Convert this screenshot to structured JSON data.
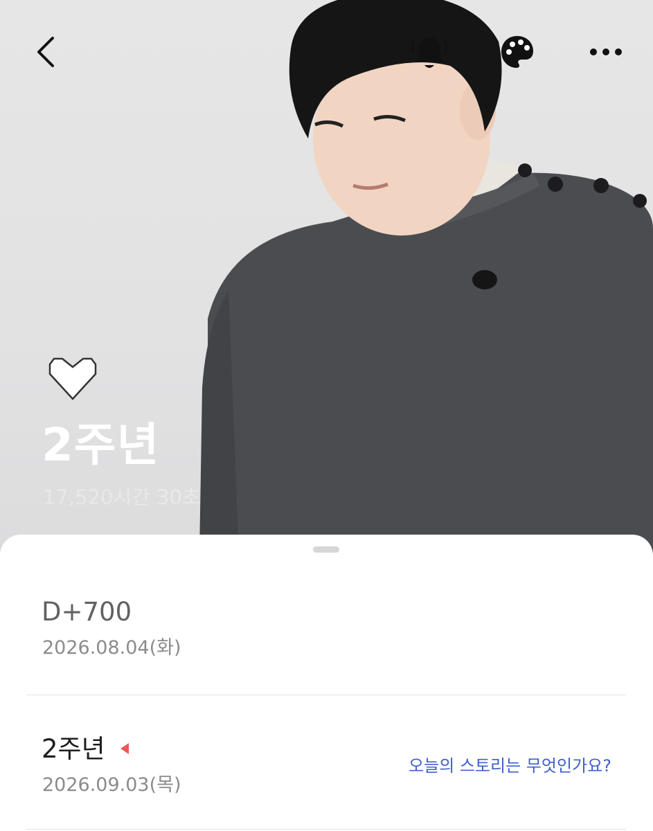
{
  "header": {
    "back_icon": "chevron-left-icon",
    "bell_icon": "bell-icon",
    "palette_icon": "palette-icon",
    "more_icon": "more-horizontal-icon"
  },
  "hero": {
    "heart_icon": "heart-outline-icon",
    "title": "2주년",
    "subtitle": "17,520시간 30초"
  },
  "events": [
    {
      "title": "D+700",
      "date": "2026.08.04(화)"
    },
    {
      "title": "2주년",
      "date": "2026.09.03(목)",
      "link": "오늘의 스토리는 무엇인가요?",
      "marker_color": "#ea5a5a"
    }
  ],
  "colors": {
    "accent_link": "#3f5fcb",
    "marker": "#ea5a5a",
    "hero_text": "#ffffff"
  }
}
